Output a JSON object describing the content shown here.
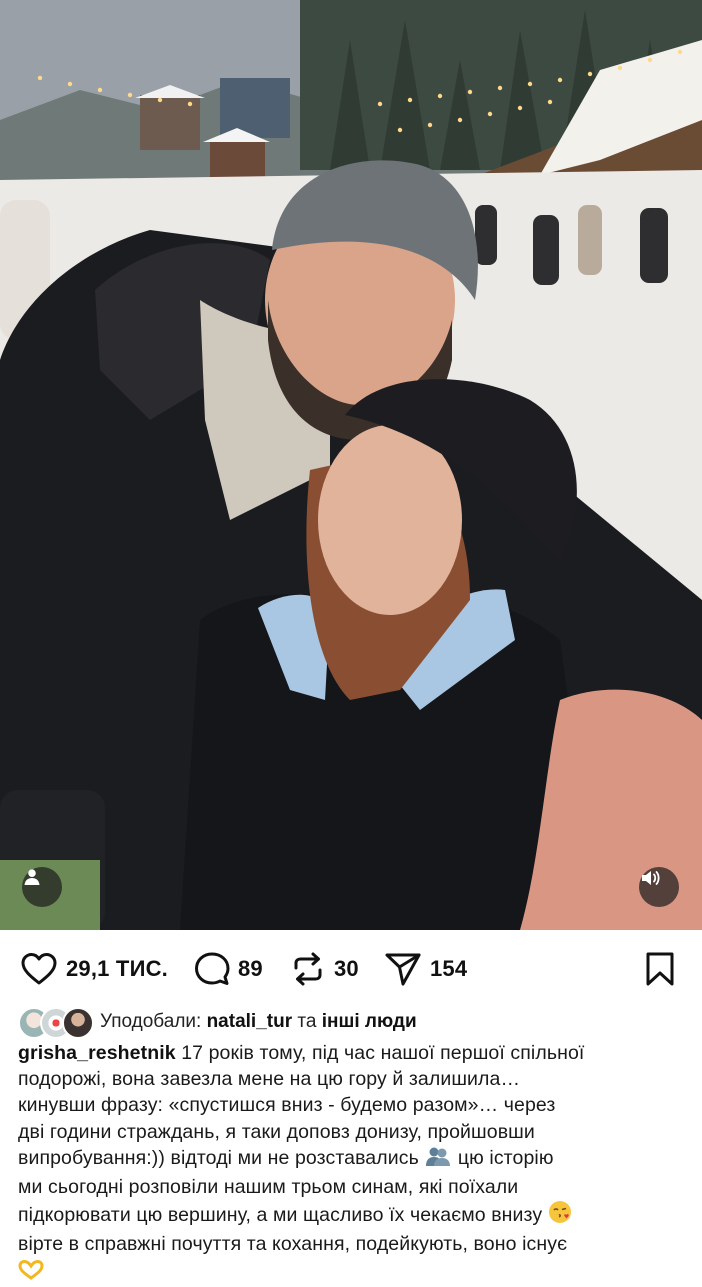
{
  "post": {
    "media": {
      "tag_icon": "person-tag-icon",
      "sound_icon": "speaker-icon"
    },
    "actions": {
      "like": {
        "icon": "heart-icon",
        "count": "29,1 ТИС."
      },
      "comment": {
        "icon": "comment-bubble-icon",
        "count": "89"
      },
      "repost": {
        "icon": "repost-arrows-icon",
        "count": "30"
      },
      "share": {
        "icon": "paper-plane-icon",
        "count": "154"
      },
      "save": {
        "icon": "bookmark-icon"
      }
    },
    "likes": {
      "prefix": "Уподобали: ",
      "user": "natali_tur",
      "middle": " та ",
      "others": "інші люди"
    },
    "caption": {
      "username": "grisha_reshetnik",
      "lines": [
        " 17 років тому, під час нашої першої спільної",
        "подорожі, вона завезла мене на цю гору й залишила…",
        "кинувши фразу: «спустишся вниз - будемо разом»… через",
        "дві години страждань, я таки доповз донизу, пройшовши",
        "випробування:)) відтоді ми не розставались",
        " цю історію",
        "ми сьогодні розповіли нашим трьом синам, які поїхали",
        "підкорювати цю вершину, а ми щасливо їх чекаємо внизу",
        "вірте в справжні почуття та кохання, подейкують, воно існує"
      ]
    }
  },
  "colors": {
    "text": "#111111",
    "overlay_button": "#1e1e1e",
    "background": "#ffffff"
  }
}
